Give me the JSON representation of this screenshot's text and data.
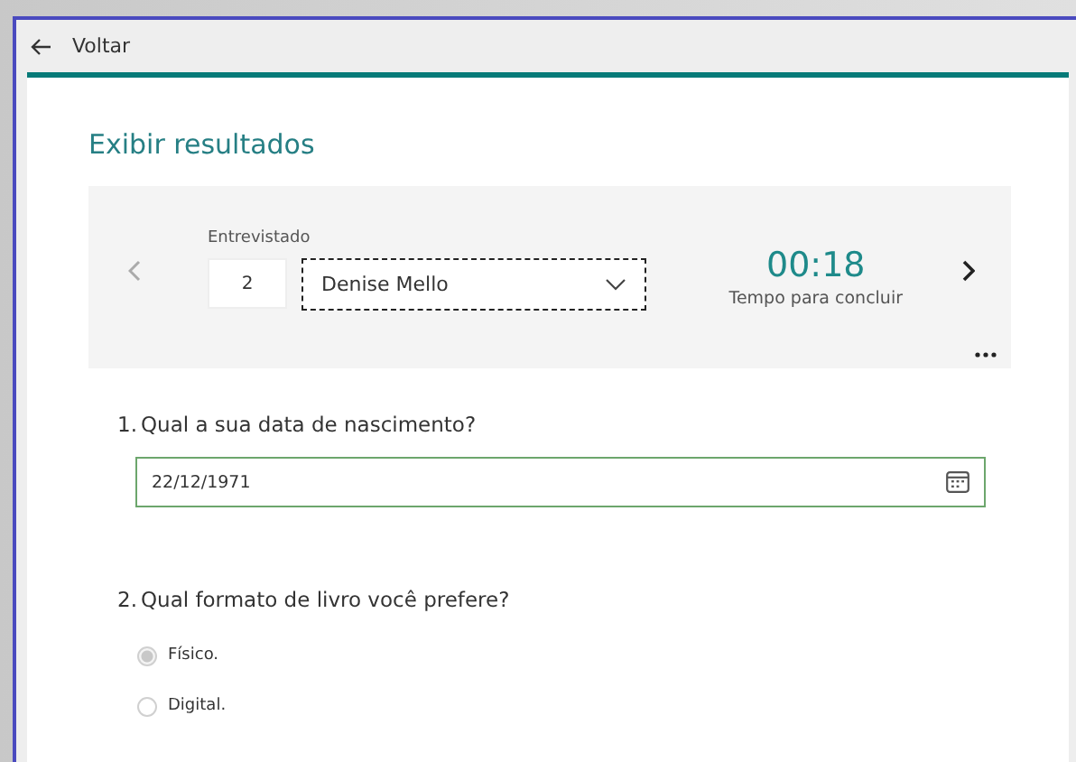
{
  "header": {
    "back_label": "Voltar"
  },
  "title": "Exibir resultados",
  "respondent": {
    "label": "Entrevistado",
    "number": "2",
    "name": "Denise Mello",
    "time": "00:18",
    "time_label": "Tempo para concluir",
    "prev_disabled": true,
    "next_disabled": false
  },
  "questions": [
    {
      "kind": "date",
      "number": "1.",
      "text": "Qual a sua data de nascimento?",
      "value": "22/12/1971"
    },
    {
      "kind": "choice",
      "number": "2.",
      "text": "Qual formato de livro você prefere?",
      "options": [
        {
          "label": "Físico.",
          "selected": true
        },
        {
          "label": "Digital.",
          "selected": false
        }
      ]
    }
  ]
}
